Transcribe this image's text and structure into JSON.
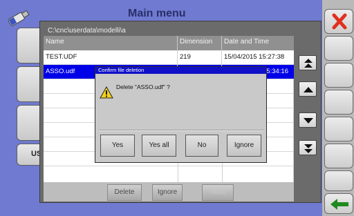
{
  "background_title": "Main menu",
  "dialog": {
    "path": "C:\\cnc\\userdata\\modelli\\a",
    "columns": [
      "Name",
      "Dimension",
      "Date and Time"
    ],
    "rows": [
      {
        "name": "TEST.UDF",
        "dimension": "219",
        "datetime": "15/04/2015 15:27:38"
      },
      {
        "name": "ASSO.udf",
        "dimension": "",
        "datetime": "5:34:16"
      }
    ],
    "footer": {
      "delete": "Delete",
      "ignore": "Ignore",
      "multi": "Multi"
    }
  },
  "confirm": {
    "title": "Confirm file deletion",
    "message": "Delete \"ASSO.udf\" ?",
    "buttons": {
      "yes": "Yes",
      "yes_all": "Yes all",
      "no": "No",
      "ignore": "Ignore"
    }
  },
  "left_label": "US",
  "colors": {
    "background": "#6f7ad0",
    "selection": "#0000e8",
    "close": "#e03020",
    "back_arrow": "#1f8a1f"
  },
  "icons": [
    "usb-drive-icon",
    "close-icon",
    "page-up-icon",
    "scroll-up-icon",
    "scroll-down-icon",
    "page-down-icon",
    "warning-icon",
    "back-arrow-icon"
  ]
}
